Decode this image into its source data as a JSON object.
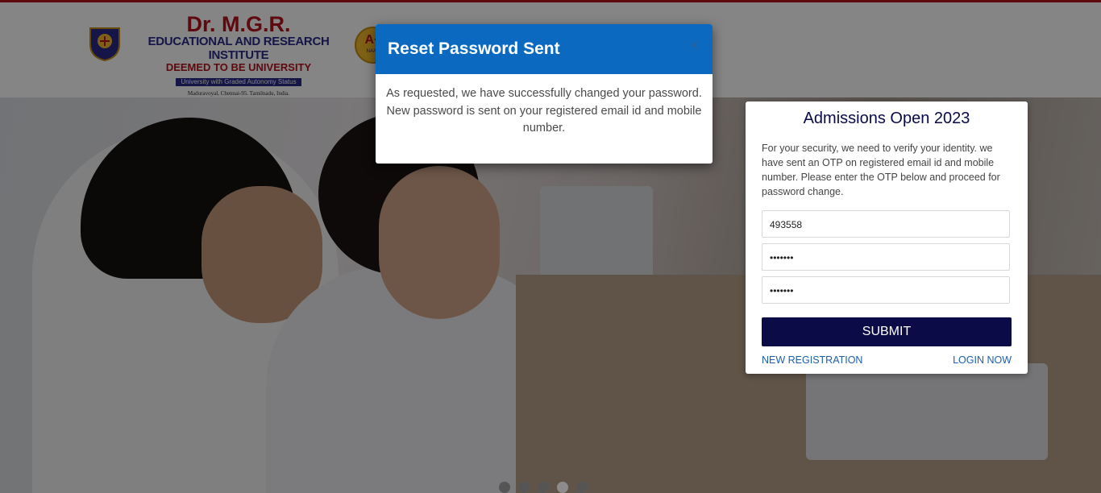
{
  "header": {
    "logo_title": "Dr. M.G.R.",
    "logo_sub": "EDUCATIONAL AND RESEARCH INSTITUTE",
    "logo_deemed": "DEEMED TO BE UNIVERSITY",
    "logo_autonomy": "University with Graded Autonomy Status",
    "logo_address": "Maduravoyal, Chennai-95. Tamilnadu, India.",
    "naac_grade": "A+",
    "naac_label": "NAAC"
  },
  "form": {
    "title": "Admissions Open 2023",
    "description": "For your security, we need to verify your identity. we have sent an OTP on registered email id and mobile number. Please enter the OTP below and proceed for password change.",
    "otp_value": "493558",
    "password_value": "•••••••",
    "confirm_password_value": "•••••••",
    "submit_label": "SUBMIT",
    "new_registration_label": "NEW REGISTRATION",
    "login_label": "LOGIN NOW"
  },
  "modal": {
    "title": "Reset Password Sent",
    "close_symbol": "×",
    "message": "As requested, we have successfully changed your password. New password is sent on your registered email id and mobile number."
  },
  "carousel": {
    "slide_count": 5,
    "active_index": 3
  },
  "colors": {
    "brand_red": "#b5121b",
    "brand_navy": "#0b0b48",
    "modal_blue": "#0b6abf",
    "link_blue": "#1b5fae"
  }
}
